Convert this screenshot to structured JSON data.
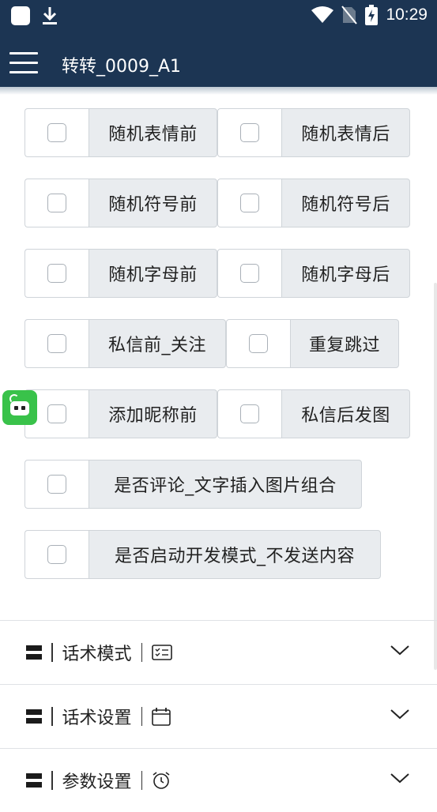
{
  "status_bar": {
    "time": "10:29",
    "icons": [
      "app-square-icon",
      "download-icon",
      "wifi-icon",
      "no-sim-icon",
      "battery-charging-icon"
    ]
  },
  "app_bar": {
    "title": "转转_0009_A1",
    "menu_icon": "hamburger-menu-icon",
    "background": "#1c3553"
  },
  "options": {
    "row1": [
      {
        "label": "随机表情前",
        "checked": false
      },
      {
        "label": "随机表情后",
        "checked": false
      }
    ],
    "row2": [
      {
        "label": "随机符号前",
        "checked": false
      },
      {
        "label": "随机符号后",
        "checked": false
      }
    ],
    "row3": [
      {
        "label": "随机字母前",
        "checked": false
      },
      {
        "label": "随机字母后",
        "checked": false
      }
    ],
    "row4": [
      {
        "label": "私信前_关注",
        "checked": false
      },
      {
        "label": "重复跳过",
        "checked": false
      }
    ],
    "row5": [
      {
        "label": "添加昵称前",
        "checked": false
      },
      {
        "label": "私信后发图",
        "checked": false
      }
    ],
    "row6": [
      {
        "label": "是否评论_文字插入图片组合",
        "checked": false
      }
    ],
    "row7": [
      {
        "label": "是否启动开发模式_不发送内容",
        "checked": false
      }
    ]
  },
  "sections": [
    {
      "label": "话术模式",
      "icon": "checklist-card-icon",
      "expanded": false
    },
    {
      "label": "话术设置",
      "icon": "calendar-icon",
      "expanded": false
    },
    {
      "label": "参数设置",
      "icon": "alarm-clock-icon",
      "expanded": false
    }
  ],
  "floating_widget": {
    "icon": "robot-assistant-icon",
    "color": "#39c24a"
  },
  "colors": {
    "header": "#1c3553",
    "label_bg": "#e9ecef",
    "border": "#cfd4d9"
  }
}
